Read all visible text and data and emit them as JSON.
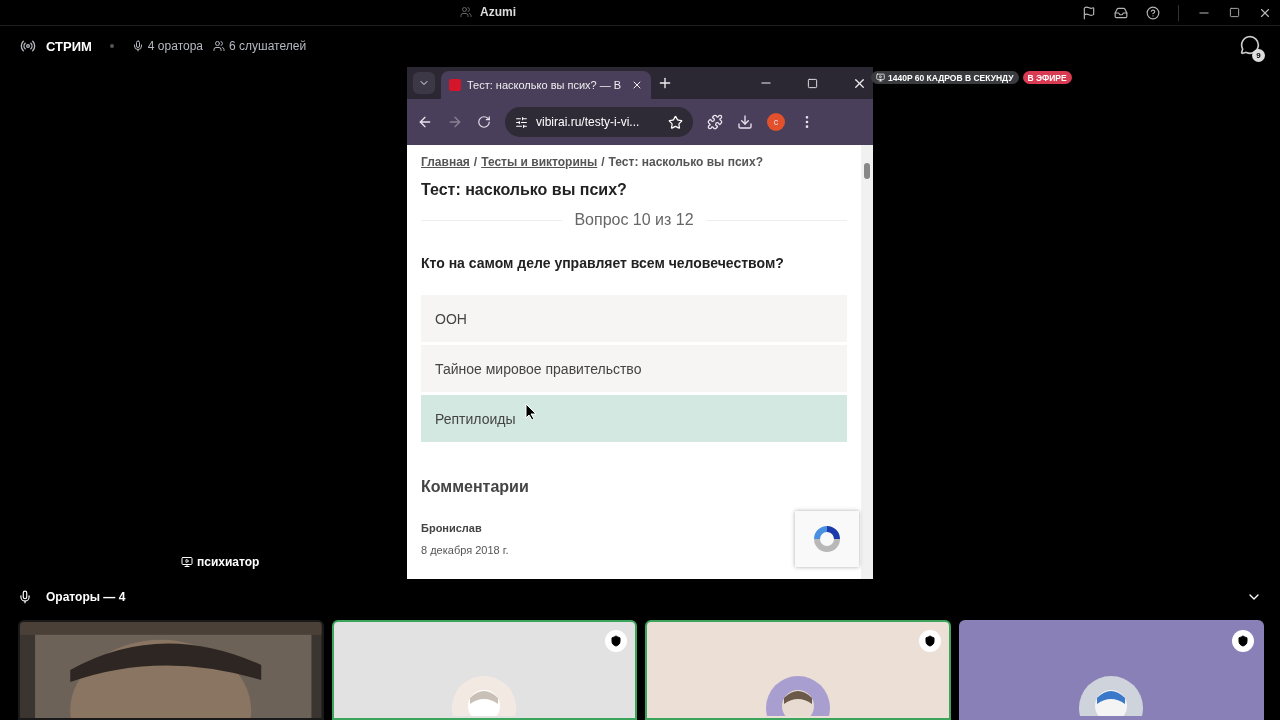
{
  "window": {
    "title": "Azumi"
  },
  "header": {
    "title": "СТРИМ",
    "speakers": "4 оратора",
    "listeners": "6 слушателей",
    "chat_count": "9"
  },
  "stream": {
    "quality": "1440P 60 КАДРОВ В СЕКУНДУ",
    "live": "В ЭФИРЕ",
    "streamer": "психиатор",
    "browser": {
      "tab_title": "Тест: насколько вы псих? — В",
      "url": "vibirai.ru/testy-i-vi...",
      "profile_initial": "c",
      "breadcrumbs": [
        {
          "label": "Главная",
          "kind": "link"
        },
        {
          "label": "/",
          "kind": "separator"
        },
        {
          "label": "Тесты и викторины",
          "kind": "link"
        },
        {
          "label": "/",
          "kind": "separator"
        },
        {
          "label": "Тест: насколько вы псих?",
          "kind": "current"
        }
      ],
      "page_title": "Тест: насколько вы псих?",
      "progress": "Вопрос 10 из 12",
      "question": "Кто на самом деле управляет всем человечеством?",
      "answers": [
        {
          "label": "ООН",
          "selected": false
        },
        {
          "label": "Тайное мировое правительство",
          "selected": false
        },
        {
          "label": "Рептилоиды",
          "selected": true
        }
      ],
      "comments_title": "Комментарии",
      "comments": [
        {
          "author": "Бронислав",
          "date": "8 декабря 2018 г."
        }
      ]
    }
  },
  "speakers_section": {
    "title": "Ораторы — 4",
    "expanded": true
  },
  "tiles": [
    {
      "kind": "camera",
      "speaking": false,
      "moderator": false
    },
    {
      "kind": "avatar",
      "speaking": true,
      "moderator": true,
      "color": "#e3e2e2"
    },
    {
      "kind": "avatar",
      "speaking": true,
      "moderator": true,
      "color": "#ecdfd6"
    },
    {
      "kind": "avatar",
      "speaking": false,
      "moderator": true,
      "color": "#8a80b8"
    }
  ]
}
